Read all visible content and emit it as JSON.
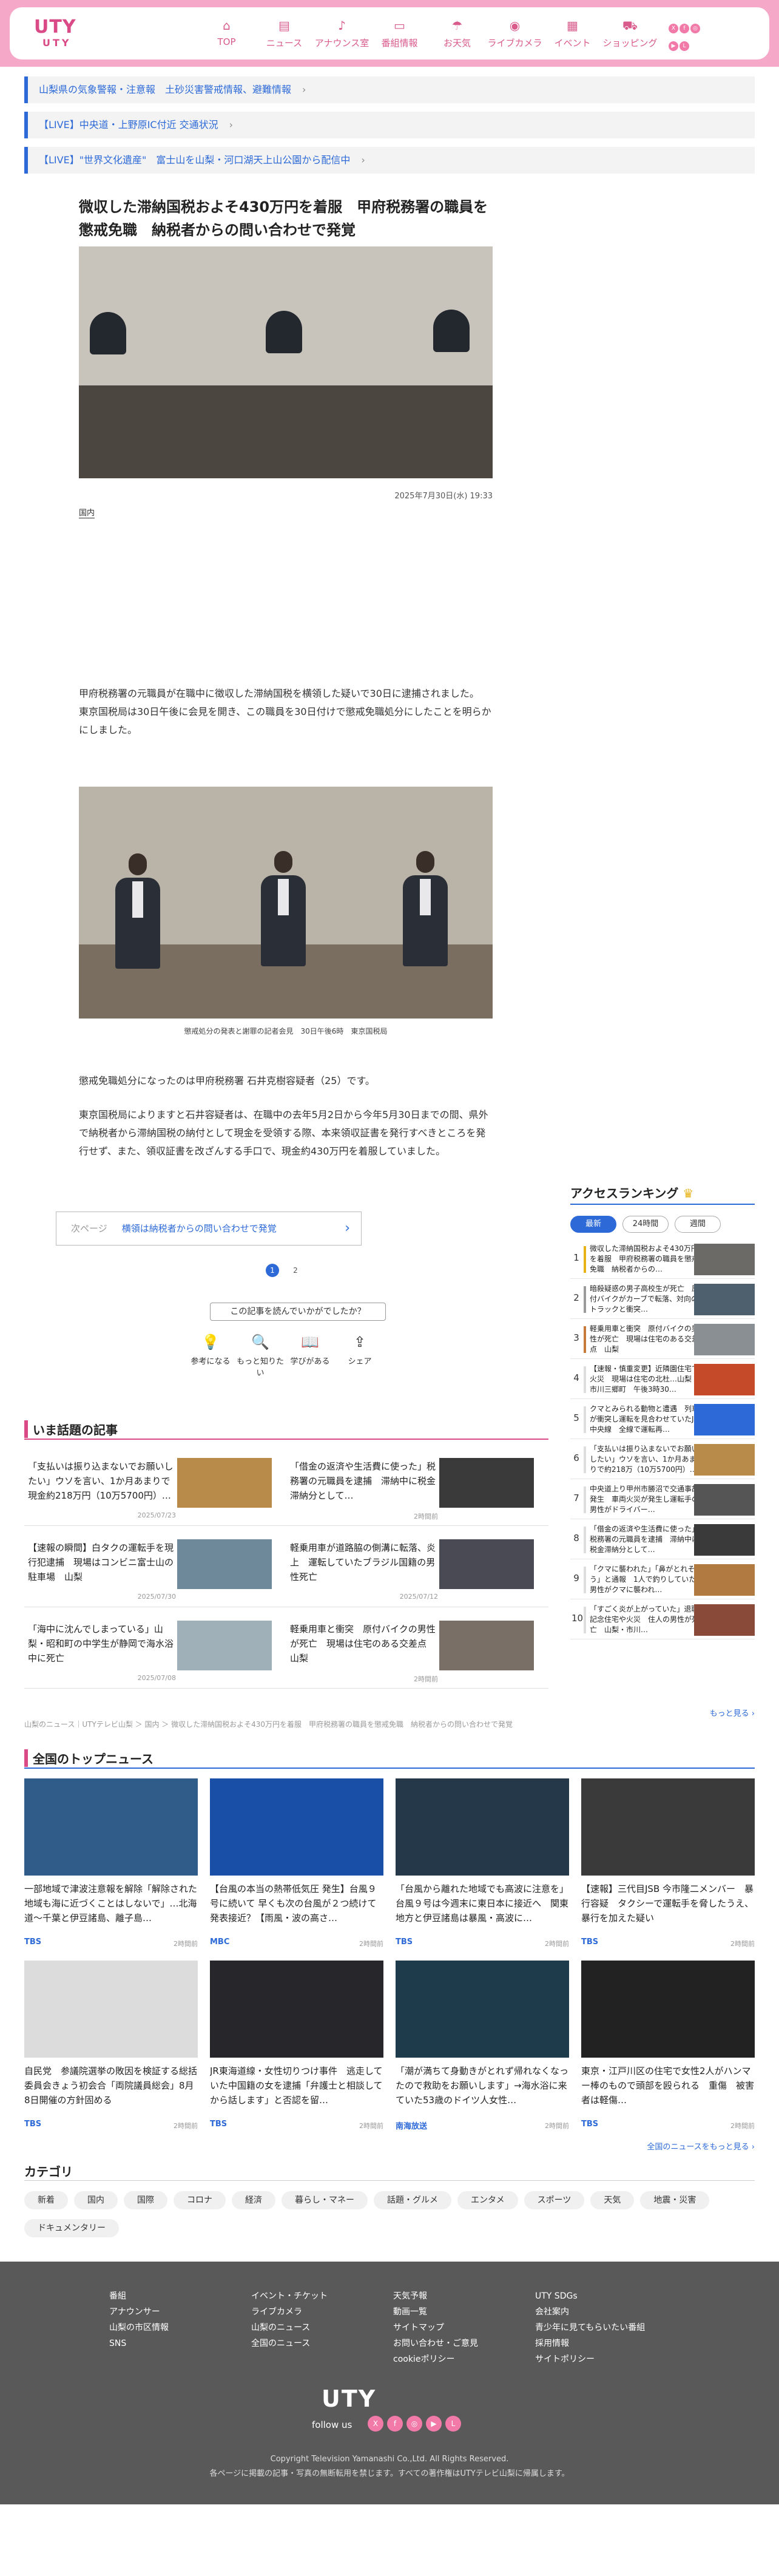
{
  "header": {
    "logo_main": "UTY",
    "logo_sub": "UTY",
    "nav": [
      {
        "label": "TOP",
        "icon": "home-icon",
        "glyph": "⌂"
      },
      {
        "label": "ニュース",
        "icon": "news-icon",
        "glyph": "▤"
      },
      {
        "label": "アナウンス室",
        "icon": "mic-icon",
        "glyph": "♪"
      },
      {
        "label": "番組情報",
        "icon": "tv-icon",
        "glyph": "▭"
      },
      {
        "label": "お天気",
        "icon": "umbrella-icon",
        "glyph": "☂"
      },
      {
        "label": "ライブカメラ",
        "icon": "camera-icon",
        "glyph": "◉"
      },
      {
        "label": "イベント",
        "icon": "calendar-icon",
        "glyph": "▦"
      },
      {
        "label": "ショッピング",
        "icon": "cart-icon",
        "glyph": "⛟"
      }
    ]
  },
  "alerts": [
    "山梨県の気象警報・注意報　土砂災害警戒情報、避難情報",
    "【LIVE】中央道・上野原IC付近 交通状況",
    "【LIVE】\"世界文化遺産\"　富士山を山梨・河口湖天上山公園から配信中"
  ],
  "article": {
    "title": "微収した滞納国税およそ430万円を着服　甲府税務署の職員を懲戒免職　納税者からの問い合わせで発覚",
    "date": "2025年7月30日(水) 19:33",
    "category": "国内",
    "para1": "甲府税務署の元職員が在職中に徴収した滞納国税を横領した疑いで30日に逮捕されました。",
    "para2": "東京国税局は30日午後に会見を開き、この職員を30日付けで懲戒免職処分にしたことを明らかにしました。",
    "caption": "懲戒処分の発表と謝罪の記者会見　30日午後6時　東京国税局",
    "para3": "懲戒免職処分になったのは甲府税務署 石井克樹容疑者（25）です。",
    "para4": "東京国税局によりますと石井容疑者は、在職中の去年5月2日から今年5月30日までの間、県外で納税者から滞納国税の納付として現金を受領する際、本来領収証書を発行すべきところを発行せず、また、領収証書を改ざんする手口で、現金約430万円を着服していました。"
  },
  "next": {
    "label": "次ページ",
    "title": "横領は納税者からの問い合わせで発覚"
  },
  "pager": [
    "1",
    "2"
  ],
  "reaction": {
    "question": "この記事を読んでいかがでしたか？",
    "buttons": [
      {
        "label": "参考になる",
        "glyph": "💡",
        "icon": "bulb-icon"
      },
      {
        "label": "もっと知りたい",
        "glyph": "🔍",
        "icon": "search-icon"
      },
      {
        "label": "学びがある",
        "glyph": "📖",
        "icon": "book-icon"
      },
      {
        "label": "シェア",
        "glyph": "⇪",
        "icon": "share-icon"
      }
    ]
  },
  "topics": {
    "heading": "いま話題の記事",
    "items": [
      {
        "title": "「支払いは振り込まないでお願いしたい」ウソを言い、1か月あまりで現金約218万円（10万5700円）…",
        "time": "2025/07/23"
      },
      {
        "title": "「借金の返済や生活費に使った」税務署の元職員を逮捕　滞納中に税金滞納分として…",
        "time": "2時間前"
      },
      {
        "title": "【速報の瞬間】白タクの運転手を現行犯逮捕　現場はコンビニ富士山の駐車場　山梨",
        "time": "2025/07/30"
      },
      {
        "title": "軽乗用車が道路脇の側溝に転落、炎上　運転していたブラジル国籍の男性死亡",
        "time": "2025/07/12"
      },
      {
        "title": "「海中に沈んでしまっている」山梨・昭和町の中学生が静岡で海水浴中に死亡",
        "time": "2025/07/08"
      },
      {
        "title": "軽乗用車と衝突　原付バイクの男性が死亡　現場は住宅のある交差点　山梨",
        "time": "2時間前"
      }
    ]
  },
  "ranking": {
    "heading": "アクセスランキング",
    "tabs": [
      "最新",
      "24時間",
      "週間"
    ],
    "items": [
      {
        "rank": "1",
        "title": "微収した滞納国税およそ430万円を着服　甲府税務署の職員を懲戒免職　納税者からの…",
        "color": "#e8b317"
      },
      {
        "rank": "2",
        "title": "暗殺疑惑の男子高校生が死亡　原付バイクがカーブで転落、対向のトラックと衝突…",
        "color": "#9a9a9a"
      },
      {
        "rank": "3",
        "title": "軽乗用車と衝突　原付バイクの男性が死亡　現場は住宅のある交差点　山梨",
        "color": "#c87a3b"
      },
      {
        "rank": "4",
        "title": "【速報・慎重変更】近隣園住宅で火災　現場は住宅の北杜…山梨・市川三郷町　午後3時30…",
        "color": "#dddddd"
      },
      {
        "rank": "5",
        "title": "クマとみられる動物と遭遇　列車が衝突し運転を見合わせていたJR中央線　全線で運転再…",
        "color": "#dddddd"
      },
      {
        "rank": "6",
        "title": "「支払いは振り込まないでお願いしたい」ウソを言い、1か月あまりで約218万（10万5700円）…",
        "color": "#dddddd"
      },
      {
        "rank": "7",
        "title": "中央道上り甲州市勝沼で交通事故発生　車両火災が発生し運転手の男性がドライバー…",
        "color": "#dddddd"
      },
      {
        "rank": "8",
        "title": "「借金の返済や生活費に使った」税務署の元職員を逮捕　滞納中に税金滞納分として…",
        "color": "#dddddd"
      },
      {
        "rank": "9",
        "title": "「クマに襲われた」「鼻がとれそう」と通報　1人で釣りしていた男性がクマに襲われ…",
        "color": "#dddddd"
      },
      {
        "rank": "10",
        "title": "「すごく炎が上がっていた」退職記念住宅や火災　住人の男性が死亡　山梨・市川…",
        "color": "#dddddd"
      }
    ],
    "more": "もっと見る ›"
  },
  "breadcrumb": "山梨のニュース｜UTYテレビ山梨 ＞ 国内 ＞ 微収した滞納国税およそ430万円を着服　甲府税務署の職員を懲戒免職　納税者からの問い合わせで発覚",
  "national": {
    "heading": "全国のトップニュース",
    "items": [
      {
        "title": "一部地域で津波注意報を解除「解除された地域も海に近づくことはしないで」…北海道〜千葉と伊豆諸島、離子島…",
        "src": "TBS",
        "time": "2時間前"
      },
      {
        "title": "【台風の本当の熱帯低気圧 発生】台風９号に続いて 早くも次の台風が２つ続けて発表接近？【雨風・波の高さ…",
        "src": "MBC",
        "time": "2時間前"
      },
      {
        "title": "「台風から離れた地域でも高波に注意を」台風９号は今週末に東日本に接近へ　関東地方と伊豆諸島は暴風・高波に…",
        "src": "TBS",
        "time": "2時間前"
      },
      {
        "title": "【速報】三代目JSB 今市隆二メンバー　暴行容疑　タクシーで運転手を脅したうえ、暴行を加えた疑い",
        "src": "TBS",
        "time": "2時間前"
      },
      {
        "title": "自民党　参議院選挙の敗因を検証する総括委員会きょう初会合「両院議員総会」8月8日開催の方針固める",
        "src": "TBS",
        "time": "2時間前"
      },
      {
        "title": "JR東海道線・女性切りつけ事件　逃走していた中国籍の女を逮捕「弁護士と相談してから話します」と否認を留…",
        "src": "TBS",
        "time": "2時間前"
      },
      {
        "title": "「潮が満ちて身動きがとれず帰れなくなったので救助をお願いします」→海水浴に来ていた53歳のドイツ人女性…",
        "src": "南海放送",
        "time": "2時間前"
      },
      {
        "title": "東京・江戸川区の住宅で女性2人がハンマー棒のもので頭部を殴られる　重傷　被害者は軽傷…",
        "src": "TBS",
        "time": "2時間前"
      }
    ],
    "more": "全国のニュースをもっと見る ›"
  },
  "categories": {
    "heading": "カテゴリ",
    "items": [
      "新着",
      "国内",
      "国際",
      "コロナ",
      "経済",
      "暮らし・マネー",
      "話題・グルメ",
      "エンタメ",
      "スポーツ",
      "天気",
      "地震・災害",
      "ドキュメンタリー"
    ]
  },
  "footer": {
    "col1": [
      "番組",
      "アナウンサー",
      "山梨の市区情報",
      "SNS"
    ],
    "col2": [
      "イベント・チケット",
      "ライブカメラ",
      "山梨のニュース",
      "全国のニュース"
    ],
    "col3": [
      "天気予報",
      "動画一覧",
      "サイトマップ",
      "お問い合わせ・ご意見",
      "cookieポリシー"
    ],
    "col4": [
      "UTY SDGs",
      "会社案内",
      "青少年に見てもらいたい番組",
      "採用情報",
      "サイトポリシー"
    ],
    "logo": "UTY",
    "follow": "follow us",
    "copyright": "Copyright Television Yamanashi Co.,Ltd. All Rights Reserved.",
    "notice": "各ページに掲載の記事・写真の無断転用を禁じます。すべての著作権はUTYテレビ山梨に帰属します。"
  },
  "colors": {
    "brand_pink": "#f6a8c8",
    "accent_blue": "#2d6ad8",
    "footer_bg": "#595959"
  }
}
